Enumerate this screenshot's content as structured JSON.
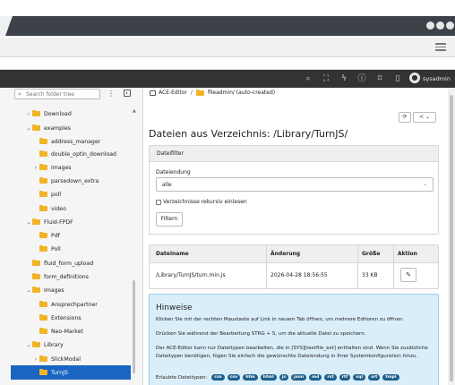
{
  "topbar": {
    "username": "sysadmin"
  },
  "tree": {
    "search_placeholder": "Search folder tree",
    "nodes": [
      {
        "label": "Download",
        "chevron": "›"
      },
      {
        "label": "examples",
        "chevron": "⌄"
      },
      {
        "label": "address_manager",
        "chevron": ""
      },
      {
        "label": "double_optin_download",
        "chevron": ""
      },
      {
        "label": "images",
        "chevron": "›"
      },
      {
        "label": "parsedown_extra",
        "chevron": ""
      },
      {
        "label": "poll",
        "chevron": ""
      },
      {
        "label": "video",
        "chevron": ""
      },
      {
        "label": "Fluid-FPDF",
        "chevron": "⌄"
      },
      {
        "label": "Pdf",
        "chevron": ""
      },
      {
        "label": "Poll",
        "chevron": ""
      },
      {
        "label": "fluid_form_upload",
        "chevron": ""
      },
      {
        "label": "form_definitions",
        "chevron": ""
      },
      {
        "label": "Images",
        "chevron": "⌄"
      },
      {
        "label": "Ansprechpartner",
        "chevron": ""
      },
      {
        "label": "Extensions",
        "chevron": ""
      },
      {
        "label": "Neo-Market",
        "chevron": ""
      },
      {
        "label": "Library",
        "chevron": "⌄"
      },
      {
        "label": "SlickModal",
        "chevron": "›"
      },
      {
        "label": "TurnJS",
        "chevron": ""
      }
    ]
  },
  "breadcrumb": {
    "module": "ACE-Editor",
    "path": "fileadmin/ (auto-created)"
  },
  "page": {
    "title": "Dateien aus Verzeichnis: /Library/TurnJS/"
  },
  "filter": {
    "heading": "Dateifilter",
    "ext_label": "Dateiendung",
    "ext_value": "alle",
    "recursive_label": "Verzeichnisse rekursiv einlesen",
    "button": "Filtern"
  },
  "table": {
    "headers": [
      "Dateiname",
      "Änderung",
      "Größe",
      "Aktion"
    ],
    "rows": [
      {
        "name": "/Library/TurnJS/turn.min.js",
        "changed": "2026-04-28 18:56:55",
        "size": "33 KB"
      }
    ]
  },
  "info": {
    "heading": "Hinweise",
    "p1": "Klicken Sie mit der rechten Maustaste auf Link in neuem Tab öffnen, um mehrere Editoren zu öffnen.",
    "p2": "Drücken Sie während der Bearbeitung STRG + S, um die aktuelle Datei zu speichern.",
    "p3": "Der ACE-Editor kann nur Dateitypen bearbeiten, die in [SYS][textfile_ext] enthalten sind. Wenn Sie zusätzliche Dateitypen benötigen, fügen Sie einfach die gewünschte Dateiendung in Ihrer Systemkonfiguration hinzu.",
    "allowed_label": "Erlaubte Dateitypen:",
    "types": [
      "css",
      "csv",
      "htm",
      "html",
      "js",
      "json",
      "md",
      "rst",
      "rtf",
      "sql",
      "srt",
      "tmpl"
    ]
  }
}
